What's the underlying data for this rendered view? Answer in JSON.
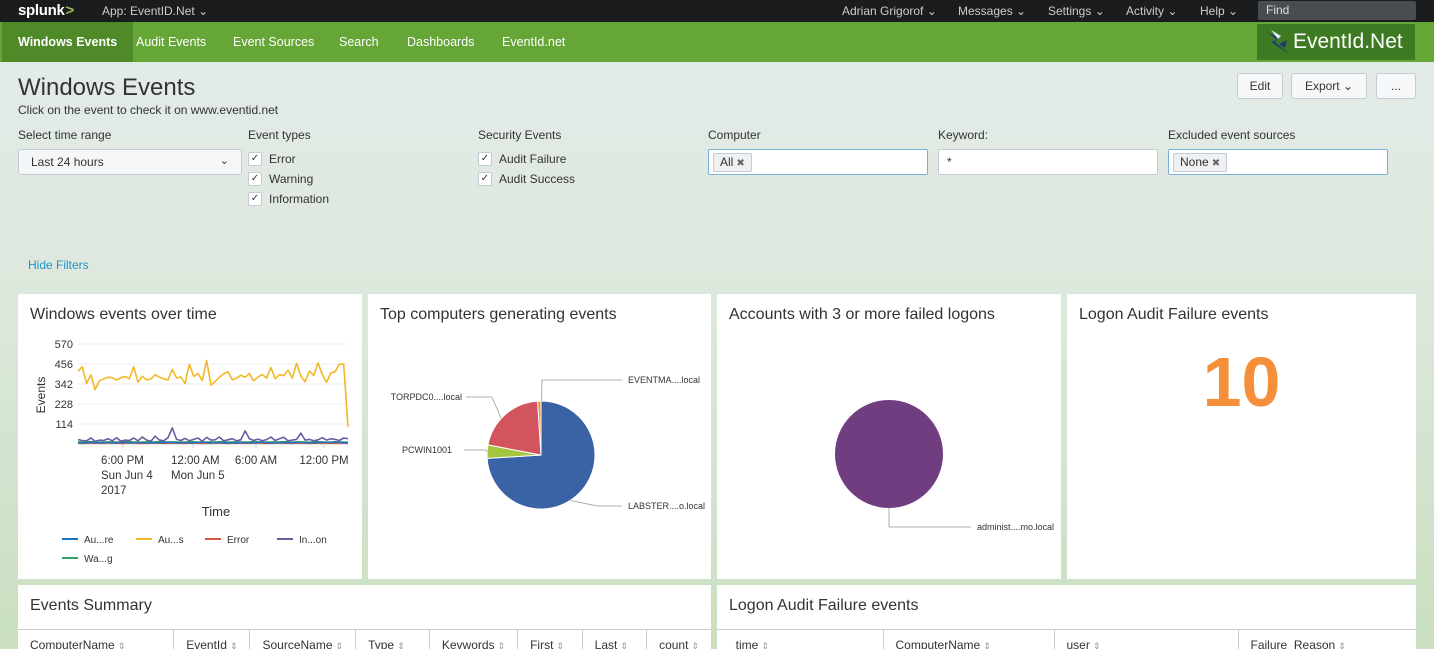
{
  "topbar": {
    "logo": "splunk",
    "logo_suffix": ">",
    "app_label": "App: EventID.Net",
    "menu": [
      "Adrian Grigorof",
      "Messages",
      "Settings",
      "Activity",
      "Help"
    ],
    "find_label": "Find"
  },
  "nav": {
    "items": [
      "Windows Events",
      "Audit Events",
      "Event Sources",
      "Search",
      "Dashboards",
      "EventId.net"
    ],
    "brand": "EventId.Net"
  },
  "header": {
    "title": "Windows Events",
    "subtitle": "Click on the event to check it on www.eventid.net",
    "edit_label": "Edit",
    "export_label": "Export",
    "more_label": "..."
  },
  "filters": {
    "time_range_label": "Select time range",
    "time_range_value": "Last 24 hours",
    "event_types_label": "Event types",
    "event_types": [
      "Error",
      "Warning",
      "Information"
    ],
    "security_label": "Security Events",
    "security_events": [
      "Audit Failure",
      "Audit Success"
    ],
    "computer_label": "Computer",
    "computer_value": "All",
    "keyword_label": "Keyword:",
    "keyword_value": "*",
    "excluded_label": "Excluded event sources",
    "excluded_value": "None",
    "hide_filters": "Hide Filters"
  },
  "panels": {
    "events_over_time": {
      "title": "Windows events over time",
      "ylabel": "Events",
      "xlabel": "Time",
      "legend": [
        "Au...re",
        "Au...s",
        "Error",
        "In...on",
        "Wa...g"
      ]
    },
    "top_computers": {
      "title": "Top computers generating events"
    },
    "failed_logons": {
      "title": "Accounts with 3 or more failed logons"
    },
    "audit_failure_count": {
      "title": "Logon Audit Failure events",
      "value": "10"
    },
    "events_summary": {
      "title": "Events Summary",
      "columns": [
        "ComputerName",
        "EventId",
        "SourceName",
        "Type",
        "Keywords",
        "First",
        "Last",
        "count"
      ]
    },
    "audit_failure_table": {
      "title": "Logon Audit Failure events",
      "columns": [
        "_time",
        "ComputerName",
        "user",
        "Failure_Reason"
      ]
    }
  },
  "colors": {
    "audit_failure": "#1e73be",
    "audit_success": "#f2b827",
    "error": "#d6563c",
    "information": "#6a5c9e",
    "warning": "#31a35f",
    "nav": "#65a637",
    "single_value": "#f58f39"
  },
  "chart_data": [
    {
      "type": "line",
      "title": "Windows events over time",
      "xlabel": "Time",
      "ylabel": "Events",
      "ylim": [
        0,
        570
      ],
      "yticks": [
        114,
        228,
        342,
        456,
        570
      ],
      "xticks": [
        "6:00 PM\nSun Jun 4\n2017",
        "12:00 AM\nMon Jun 5",
        "6:00 AM",
        "12:00 PM"
      ],
      "series": [
        {
          "name": "Au...re",
          "values": [
            8,
            6,
            10,
            7,
            9,
            8,
            6,
            10,
            7,
            8,
            9,
            6,
            8,
            7,
            10,
            8,
            6,
            9,
            7,
            8,
            10,
            6,
            9,
            8,
            7,
            6,
            9,
            8,
            7,
            10,
            8,
            6,
            9,
            8,
            7,
            10,
            8,
            6,
            9,
            10,
            8,
            12,
            8,
            6
          ]
        },
        {
          "name": "Au...s",
          "values": [
            415,
            440,
            345,
            395,
            310,
            360,
            372,
            380,
            378,
            365,
            378,
            385,
            372,
            440,
            352,
            386,
            366,
            370,
            395,
            380,
            372,
            365,
            425,
            376,
            382,
            345,
            455,
            385,
            402,
            362,
            476,
            336,
            356,
            380,
            400,
            412,
            366,
            375,
            392,
            380,
            402,
            360,
            382,
            396,
            375,
            436,
            372,
            395,
            390,
            420,
            376,
            460,
            386,
            355,
            416,
            390,
            462,
            396,
            352,
            405,
            412,
            455,
            455,
            98
          ]
        },
        {
          "name": "Error",
          "values": [
            5,
            4,
            6,
            5,
            4,
            7,
            5,
            4,
            6,
            5,
            4,
            5,
            6,
            5,
            4,
            6,
            5,
            4,
            6,
            5,
            4,
            5,
            6,
            5,
            4,
            6,
            5,
            4,
            6,
            5,
            4,
            5,
            6,
            5,
            4,
            6,
            5,
            4,
            5,
            6,
            5,
            4,
            6,
            5
          ]
        },
        {
          "name": "In...on",
          "values": [
            25,
            20,
            18,
            35,
            15,
            22,
            20,
            30,
            18,
            36,
            16,
            22,
            20,
            34,
            18,
            40,
            22,
            16,
            45,
            22,
            18,
            36,
            92,
            26,
            20,
            32,
            18,
            26,
            34,
            16,
            38,
            22,
            24,
            40,
            18,
            24,
            30,
            18,
            24,
            75,
            30,
            20,
            28,
            18,
            25,
            40,
            20,
            30,
            38,
            18,
            22,
            26,
            62,
            22,
            26,
            18,
            24,
            36,
            22,
            30,
            26,
            20,
            34,
            30
          ]
        },
        {
          "name": "Wa...g",
          "values": [
            12,
            10,
            13,
            11,
            10,
            12,
            11,
            10,
            13,
            11,
            10,
            12,
            11,
            13,
            10,
            12,
            11,
            10,
            13,
            11,
            10,
            12,
            11,
            13,
            10,
            12,
            11,
            10,
            13,
            11,
            10,
            12,
            11,
            13,
            10,
            12,
            11,
            10,
            13,
            11,
            10,
            12,
            11,
            10
          ]
        }
      ]
    },
    {
      "type": "pie",
      "title": "Top computers generating events",
      "categories": [
        "LABSTER....o.local",
        "PCWIN1001",
        "TORPDC0....local",
        "EVENTMA....local"
      ],
      "values": [
        74,
        4,
        21,
        1
      ],
      "colors": [
        "#3a63a5",
        "#a6c53f",
        "#d2545f",
        "#f58f39"
      ]
    },
    {
      "type": "pie",
      "title": "Accounts with 3 or more failed logons",
      "categories": [
        "administ....mo.local"
      ],
      "values": [
        100
      ],
      "colors": [
        "#6f3d80"
      ]
    }
  ]
}
